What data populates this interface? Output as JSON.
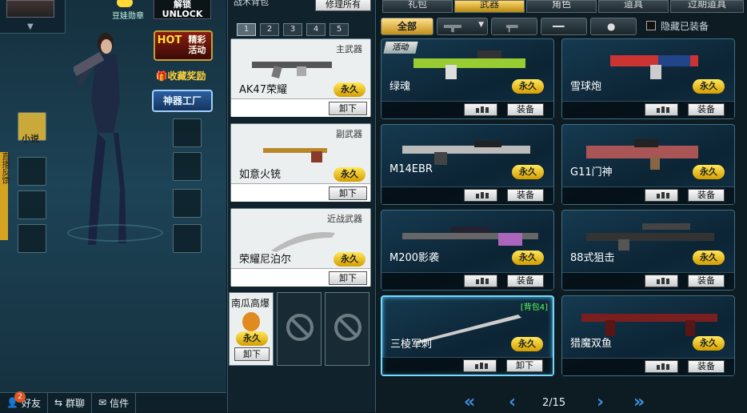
{
  "left": {
    "badge_label": "豆娃勋章",
    "unlock_label": "UNLOCK",
    "unlock_cn": "解锁",
    "hot_label": "HOT",
    "hot_sub": "精彩活动",
    "favorite_reward": "收藏奖励",
    "weapon_factory": "神器工厂",
    "novel_label": "小说",
    "sidetab_text": "直播反馈",
    "bottom": {
      "friend_count": "2",
      "friends": "好友",
      "group_chat": "群聊",
      "mail": "信件"
    }
  },
  "middle": {
    "bag_label": "战术背包",
    "repair_all": "修理所有",
    "bag_pages": [
      "1",
      "2",
      "3",
      "4",
      "5"
    ],
    "selected_page": "1",
    "slots": [
      {
        "category": "主武器",
        "name": "AK47荣耀",
        "duration": "永久",
        "action": "卸下"
      },
      {
        "category": "副武器",
        "name": "如意火铳",
        "duration": "永久",
        "action": "卸下"
      },
      {
        "category": "近战武器",
        "name": "荣耀尼泊尔",
        "duration": "永久",
        "action": "卸下"
      }
    ],
    "grenade": {
      "name": "南瓜高爆",
      "duration": "永久",
      "action": "卸下"
    }
  },
  "right": {
    "tabs": [
      "礼包",
      "武器",
      "角色",
      "道具",
      "过期道具"
    ],
    "selected_tab": "武器",
    "filter_all": "全部",
    "hide_equipped": "隐藏已装备",
    "items": [
      {
        "name": "绿魂",
        "duration": "永久",
        "action": "装备",
        "tag": "活动"
      },
      {
        "name": "雪球炮",
        "duration": "永久",
        "action": "装备"
      },
      {
        "name": "M14EBR",
        "duration": "永久",
        "action": "装备"
      },
      {
        "name": "G11门神",
        "duration": "永久",
        "action": "装备"
      },
      {
        "name": "M200影袭",
        "duration": "永久",
        "action": "装备"
      },
      {
        "name": "88式狙击",
        "duration": "永久",
        "action": "装备"
      },
      {
        "name": "三棱军刺",
        "duration": "永久",
        "action": "卸下",
        "bag_tag": "[背包4]"
      },
      {
        "name": "猎魔双鱼",
        "duration": "永久",
        "action": "装备"
      }
    ],
    "page_indicator": "2/15"
  }
}
